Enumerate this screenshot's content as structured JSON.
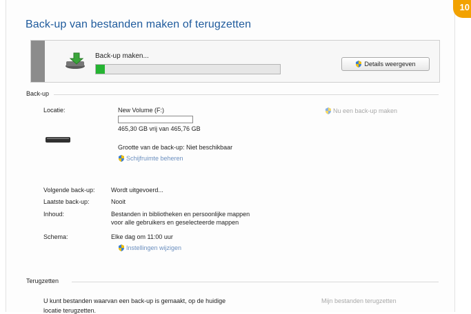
{
  "badge": "10",
  "title": "Back-up van bestanden maken of terugzetten",
  "progress": {
    "label": "Back-up maken...",
    "fraction": 0.05,
    "details_button": "Details weergeven"
  },
  "backup": {
    "section_title": "Back-up",
    "location_label": "Locatie:",
    "location_value": "New Volume (F:)",
    "drive_used_fraction": 0.0,
    "free_space": "465,30 GB vrij van 465,76 GB",
    "backup_size": "Grootte van de back-up: Niet beschikbaar",
    "manage_space_link": "Schijfruimte beheren",
    "backup_now_button": "Nu een back-up maken",
    "next_label": "Volgende back-up:",
    "next_value": "Wordt uitgevoerd...",
    "last_label": "Laatste back-up:",
    "last_value": "Nooit",
    "contents_label": "Inhoud:",
    "contents_value_line1": "Bestanden in bibliotheken en persoonlijke mappen",
    "contents_value_line2": "voor alle gebruikers en geselecteerde mappen",
    "schedule_label": "Schema:",
    "schedule_value": "Elke dag om 11:00 uur",
    "change_settings_link": "Instellingen wijzigen"
  },
  "restore": {
    "section_title": "Terugzetten",
    "text_line1": "U kunt bestanden waarvan een back-up is gemaakt, op de huidige",
    "text_line2": "locatie terugzetten.",
    "restore_button": "Mijn bestanden terugzetten"
  },
  "colors": {
    "title": "#1e5a9c",
    "progress_fill": "#25b432",
    "link": "#6b8fbf",
    "badge": "#f2a200"
  }
}
